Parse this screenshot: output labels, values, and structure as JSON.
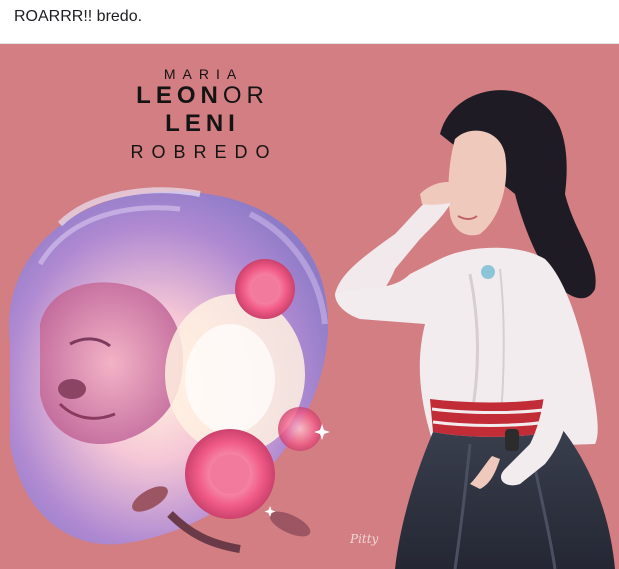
{
  "post": {
    "caption": "ROARRR!! bredo."
  },
  "artwork": {
    "title_line1": "MARIA",
    "title_line2_bold": "LEON",
    "title_line2_thin": "OR",
    "title_line3": "LENI",
    "title_line4": "ROBREDO",
    "signature": "Pitty",
    "background_color": "#d37e82",
    "subjects": [
      "lion-with-roses",
      "saluting-woman"
    ]
  }
}
